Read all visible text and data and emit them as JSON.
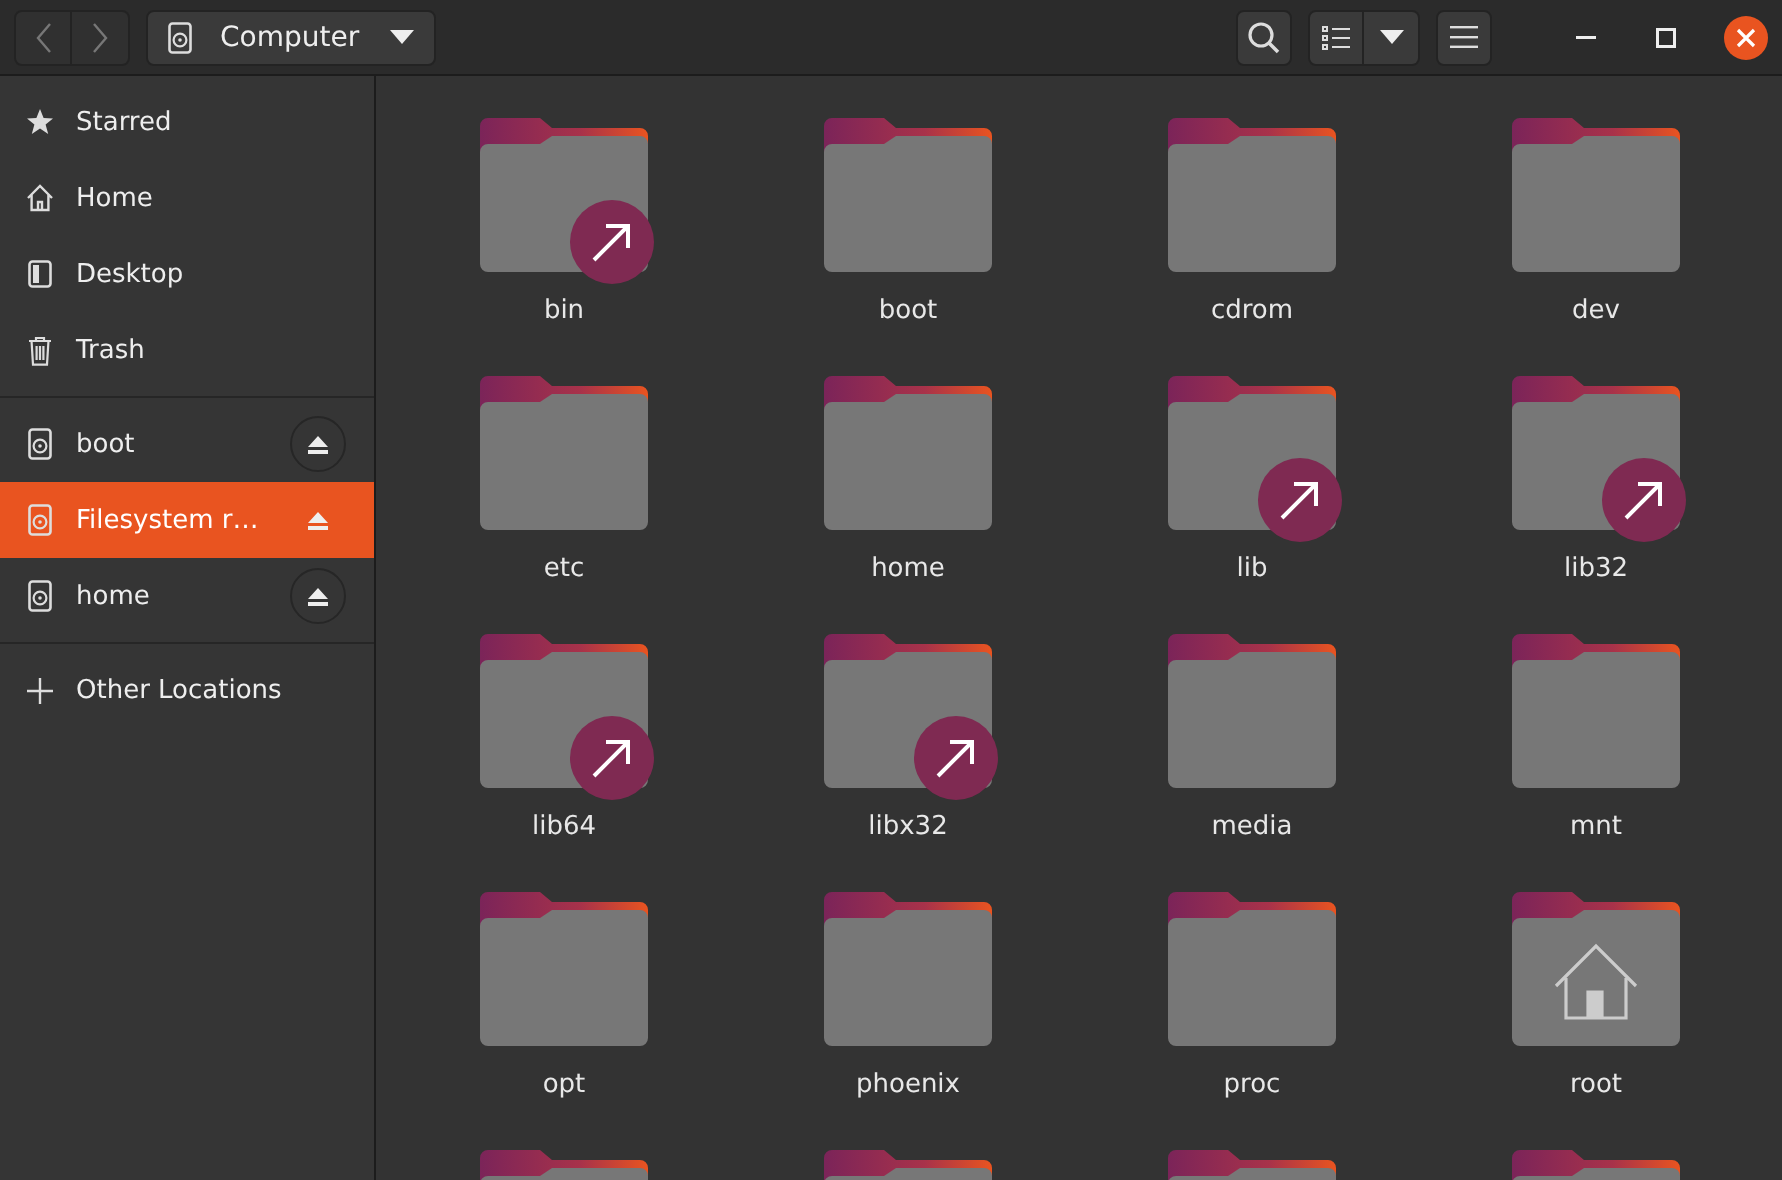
{
  "header": {
    "location": "Computer"
  },
  "sidebar": {
    "sections": [
      {
        "items": [
          {
            "kind": "starred",
            "label": "Starred",
            "selected": false
          },
          {
            "kind": "home",
            "label": "Home",
            "selected": false
          },
          {
            "kind": "desktop",
            "label": "Desktop",
            "selected": false
          },
          {
            "kind": "trash",
            "label": "Trash",
            "selected": false
          }
        ]
      },
      {
        "items": [
          {
            "kind": "drive",
            "label": "boot",
            "selected": false,
            "ejectable": true
          },
          {
            "kind": "drive",
            "label": "Filesystem r…",
            "selected": true,
            "ejectable": true
          },
          {
            "kind": "drive",
            "label": "home",
            "selected": false,
            "ejectable": true
          }
        ]
      },
      {
        "items": [
          {
            "kind": "other",
            "label": "Other Locations",
            "selected": false
          }
        ]
      }
    ]
  },
  "folders": [
    {
      "name": "bin",
      "kind": "link"
    },
    {
      "name": "boot",
      "kind": "plain"
    },
    {
      "name": "cdrom",
      "kind": "plain"
    },
    {
      "name": "dev",
      "kind": "plain"
    },
    {
      "name": "etc",
      "kind": "plain"
    },
    {
      "name": "home",
      "kind": "plain"
    },
    {
      "name": "lib",
      "kind": "link"
    },
    {
      "name": "lib32",
      "kind": "link"
    },
    {
      "name": "lib64",
      "kind": "link"
    },
    {
      "name": "libx32",
      "kind": "link"
    },
    {
      "name": "media",
      "kind": "plain"
    },
    {
      "name": "mnt",
      "kind": "plain"
    },
    {
      "name": "opt",
      "kind": "plain"
    },
    {
      "name": "phoenix",
      "kind": "plain"
    },
    {
      "name": "proc",
      "kind": "plain"
    },
    {
      "name": "root",
      "kind": "home"
    },
    {
      "kind": "plain"
    },
    {
      "kind": "plain"
    },
    {
      "kind": "plain"
    },
    {
      "kind": "plain"
    }
  ]
}
